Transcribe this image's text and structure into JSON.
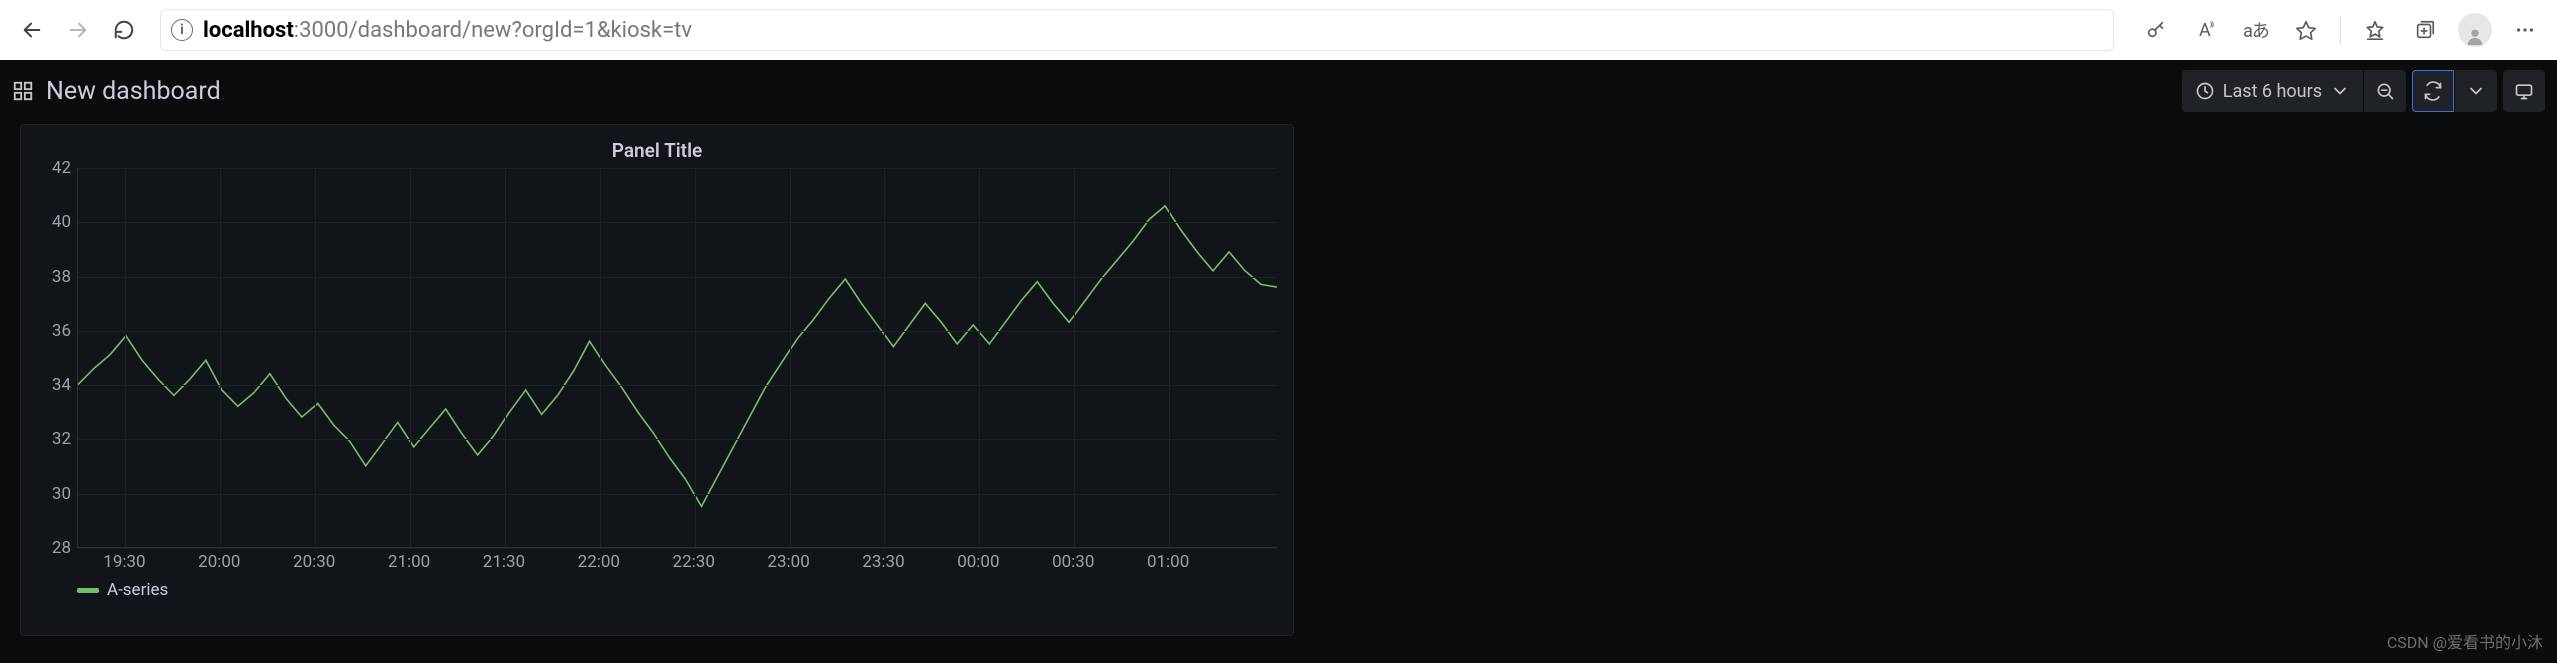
{
  "browser": {
    "url_host": "localhost",
    "url_rest": ":3000/dashboard/new?orgId=1&kiosk=tv",
    "translate_label": "aあ"
  },
  "dashboard": {
    "title": "New dashboard",
    "time_range_label": "Last 6 hours"
  },
  "panel": {
    "title": "Panel Title",
    "legend_series": "A-series"
  },
  "watermark": "CSDN @爱看书的小沐",
  "chart_data": {
    "type": "line",
    "title": "Panel Title",
    "xlabel": "",
    "ylabel": "",
    "ylim": [
      28,
      42
    ],
    "y_ticks": [
      28,
      30,
      32,
      34,
      36,
      38,
      40,
      42
    ],
    "x_ticks": [
      "19:30",
      "20:00",
      "20:30",
      "21:00",
      "21:30",
      "22:00",
      "22:30",
      "23:00",
      "23:30",
      "00:00",
      "00:30",
      "01:00"
    ],
    "x_range_minutes": [
      1155,
      1530
    ],
    "series": [
      {
        "name": "A-series",
        "color": "#73bf69",
        "x_minutes": [
          1155,
          1160,
          1165,
          1170,
          1175,
          1180,
          1185,
          1190,
          1195,
          1200,
          1205,
          1210,
          1215,
          1220,
          1225,
          1230,
          1235,
          1240,
          1245,
          1250,
          1255,
          1260,
          1265,
          1270,
          1275,
          1280,
          1285,
          1290,
          1295,
          1300,
          1305,
          1310,
          1315,
          1320,
          1325,
          1330,
          1335,
          1340,
          1345,
          1350,
          1355,
          1360,
          1365,
          1370,
          1375,
          1380,
          1385,
          1390,
          1395,
          1400,
          1405,
          1410,
          1415,
          1420,
          1425,
          1430,
          1435,
          1440,
          1445,
          1450,
          1455,
          1460,
          1465,
          1470,
          1475,
          1480,
          1485,
          1490,
          1495,
          1500,
          1505,
          1510,
          1515,
          1520,
          1525,
          1530
        ],
        "values": [
          34.0,
          34.6,
          35.1,
          35.8,
          34.9,
          34.2,
          33.6,
          34.2,
          34.9,
          33.8,
          33.2,
          33.7,
          34.4,
          33.5,
          32.8,
          33.3,
          32.5,
          31.9,
          31.0,
          31.8,
          32.6,
          31.7,
          32.4,
          33.1,
          32.2,
          31.4,
          32.1,
          33.0,
          33.8,
          32.9,
          33.6,
          34.5,
          35.6,
          34.7,
          33.9,
          33.0,
          32.2,
          31.3,
          30.5,
          29.5,
          30.6,
          31.7,
          32.8,
          33.9,
          34.8,
          35.7,
          36.4,
          37.2,
          37.9,
          37.0,
          36.2,
          35.4,
          36.2,
          37.0,
          36.3,
          35.5,
          36.2,
          35.5,
          36.3,
          37.1,
          37.8,
          37.0,
          36.3,
          37.1,
          37.9,
          38.6,
          39.3,
          40.1,
          40.6,
          39.7,
          38.9,
          38.2,
          38.9,
          38.2,
          37.7,
          37.6
        ]
      }
    ]
  }
}
